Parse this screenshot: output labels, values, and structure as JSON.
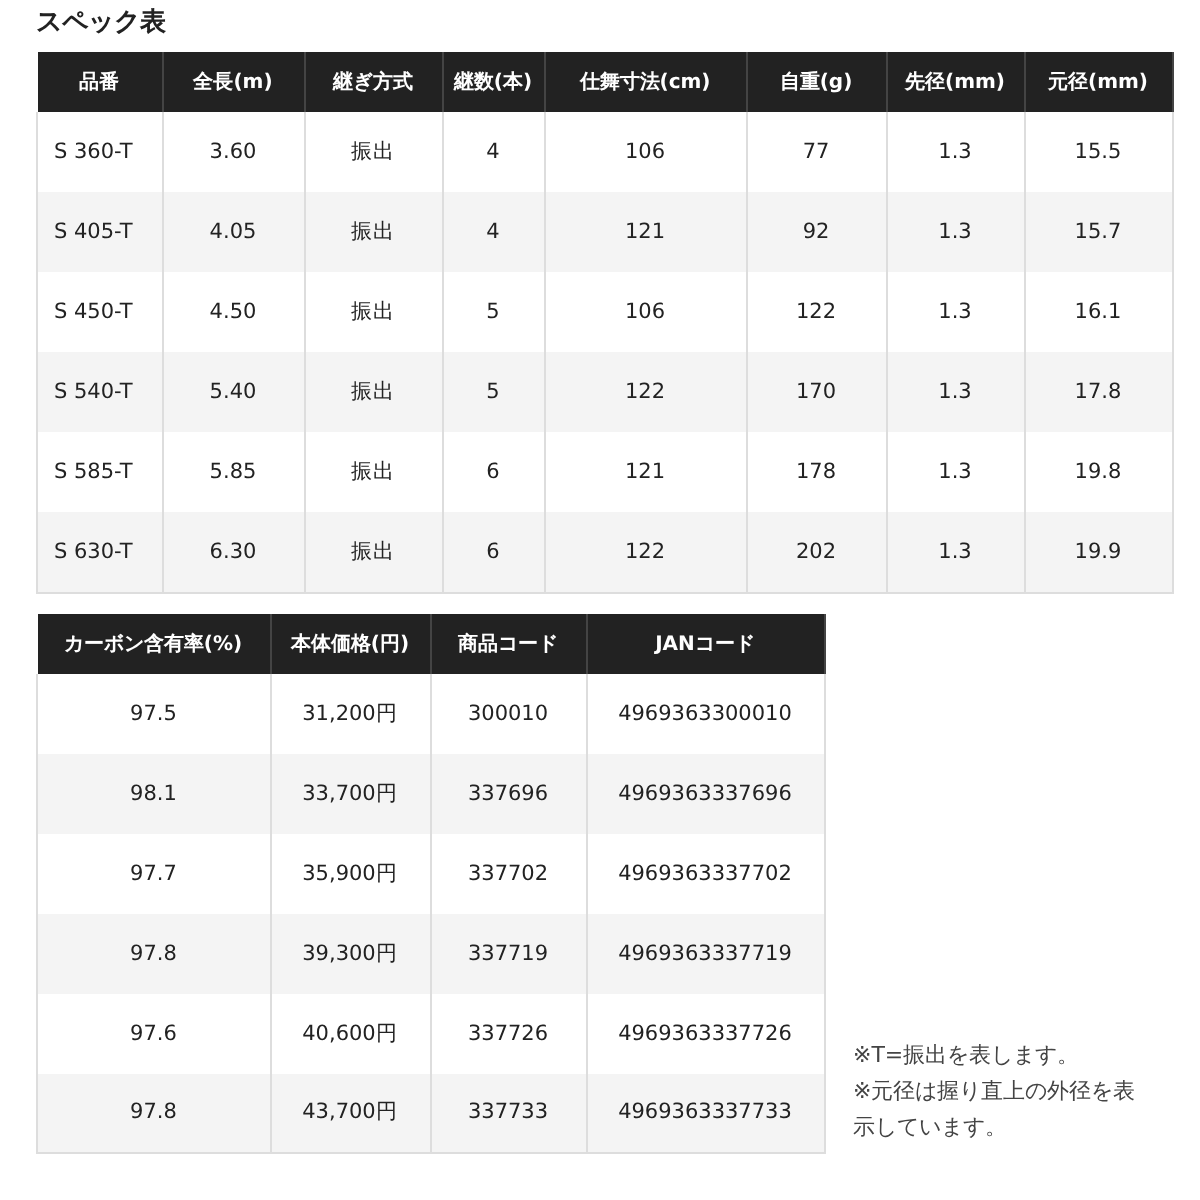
{
  "title": "スペック表",
  "spec_table": {
    "columns": [
      "品番",
      "全長(m)",
      "継ぎ方式",
      "継数(本)",
      "仕舞寸法(cm)",
      "自重(g)",
      "先径(mm)",
      "元径(mm)"
    ],
    "rows": [
      [
        "S 360-T",
        "3.60",
        "振出",
        "4",
        "106",
        "77",
        "1.3",
        "15.5"
      ],
      [
        "S 405-T",
        "4.05",
        "振出",
        "4",
        "121",
        "92",
        "1.3",
        "15.7"
      ],
      [
        "S 450-T",
        "4.50",
        "振出",
        "5",
        "106",
        "122",
        "1.3",
        "16.1"
      ],
      [
        "S 540-T",
        "5.40",
        "振出",
        "5",
        "122",
        "170",
        "1.3",
        "17.8"
      ],
      [
        "S 585-T",
        "5.85",
        "振出",
        "6",
        "121",
        "178",
        "1.3",
        "19.8"
      ],
      [
        "S 630-T",
        "6.30",
        "振出",
        "6",
        "122",
        "202",
        "1.3",
        "19.9"
      ]
    ]
  },
  "price_table": {
    "columns": [
      "カーボン含有率(%)",
      "本体価格(円)",
      "商品コード",
      "JANコード"
    ],
    "rows": [
      [
        "97.5",
        "31,200円",
        "300010",
        "4969363300010"
      ],
      [
        "98.1",
        "33,700円",
        "337696",
        "4969363337696"
      ],
      [
        "97.7",
        "35,900円",
        "337702",
        "4969363337702"
      ],
      [
        "97.8",
        "39,300円",
        "337719",
        "4969363337719"
      ],
      [
        "97.6",
        "40,600円",
        "337726",
        "4969363337726"
      ],
      [
        "97.8",
        "43,700円",
        "337733",
        "4969363337733"
      ]
    ]
  },
  "notes": [
    "※T=振出を表します。",
    "※元径は握り直上の外径を表示しています。"
  ]
}
